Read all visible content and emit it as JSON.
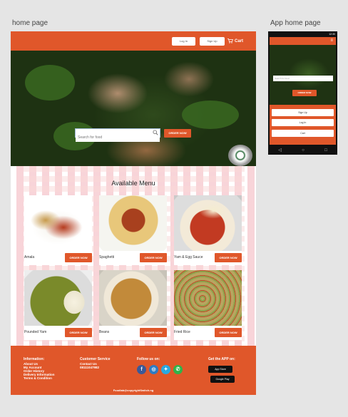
{
  "artboards": {
    "home_label": "home page",
    "app_label": "App home page"
  },
  "header": {
    "login_label": "Log In",
    "signup_label": "Sign Up",
    "cart_label": "Cart",
    "cart_icon": "cart-icon"
  },
  "hero": {
    "search_placeholder": "Search for food",
    "search_icon": "search-icon",
    "order_label": "ORDER NOW"
  },
  "menu": {
    "title": "Available Menu",
    "items": [
      {
        "name": "Amala",
        "button": "ORDER NOW"
      },
      {
        "name": "Spaghetti",
        "button": "ORDER NOW"
      },
      {
        "name": "Yam & Egg Sauce",
        "button": "ORDER NOW"
      },
      {
        "name": "Pounded Yam",
        "button": "ORDER NOW"
      },
      {
        "name": "Beans",
        "button": "ORDER NOW"
      },
      {
        "name": "Fried Rice",
        "button": "ORDER NOW"
      }
    ]
  },
  "footer": {
    "information": {
      "heading": "Information:",
      "links": [
        "About Us",
        "My Account",
        "Order History",
        "Delivery Information",
        "Terms & Condition"
      ]
    },
    "customer_service": {
      "heading": "Customer Service",
      "links": [
        "Contact Us",
        "08111047982"
      ]
    },
    "follow": {
      "heading": "Follow us on:",
      "icons": [
        "facebook-icon",
        "instagram-icon",
        "twitter-icon",
        "whatsapp-icon"
      ]
    },
    "app": {
      "heading": "Get the APP on:",
      "app_store": "App Store",
      "google_play": "Google Play"
    },
    "copyright": "Foodlab@copyrightSwitch.ng"
  },
  "app": {
    "status_time": "12:30",
    "search_placeholder": "Search for food",
    "order_label": "ORDER NOW",
    "signup_label": "Sign Up",
    "login_label": "Log In",
    "cart_label": "Cart"
  },
  "colors": {
    "accent": "#e0572a",
    "footer": "#e0572a"
  }
}
